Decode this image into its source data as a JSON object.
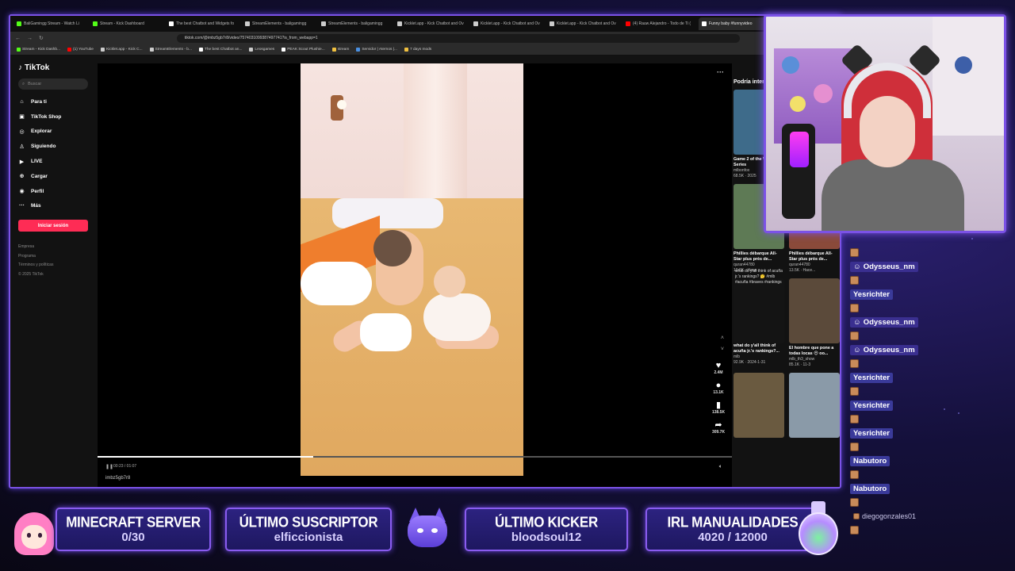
{
  "browser": {
    "tabs": [
      {
        "label": "BaliGamingg Stream - Watch Li",
        "color": "#53fc18",
        "active": false
      },
      {
        "label": "Stream - Kick Dashboard",
        "color": "#53fc18",
        "active": false
      },
      {
        "label": "The best Chatbot and Widgets fo",
        "color": "#ffffff",
        "active": false
      },
      {
        "label": "StreamElements - baligamingg",
        "color": "#cccccc",
        "active": false
      },
      {
        "label": "StreamElements - baligamingg",
        "color": "#cccccc",
        "active": false
      },
      {
        "label": "Kicklet.app - Kick Chatbot and Ov",
        "color": "#cccccc",
        "active": false
      },
      {
        "label": "Kicklet.app - Kick Chatbot and Ov",
        "color": "#cccccc",
        "active": false
      },
      {
        "label": "Kicklet.app - Kick Chatbot and Ov",
        "color": "#cccccc",
        "active": false
      },
      {
        "label": "(4) Rauw Alejandro - Todo de Ti (",
        "color": "#ff0000",
        "active": false
      },
      {
        "label": "Funny baby #funnyvideo",
        "color": "#ffffff",
        "active": true
      }
    ],
    "url": "tiktok.com/@imbz5gb7r8/video/7574031099387497741?is_from_webapp=1",
    "bookmarks": [
      {
        "label": "Stream - Kick Dashb...",
        "color": "#53fc18"
      },
      {
        "label": "(1) YouTube",
        "color": "#ff0000"
      },
      {
        "label": "Kicklet.app - Kick C...",
        "color": "#cccccc"
      },
      {
        "label": "StreamElements - b...",
        "color": "#cccccc"
      },
      {
        "label": "The best Chatbot an...",
        "color": "#ffffff"
      },
      {
        "label": "Leosgames",
        "color": "#cccccc"
      },
      {
        "label": "PEAK Scout Plushie...",
        "color": "#ffffff"
      },
      {
        "label": "stream",
        "color": "#f0c040"
      },
      {
        "label": "Servidor | Aternos |...",
        "color": "#4a90e2"
      },
      {
        "label": "7 days mods",
        "color": "#f0c040"
      }
    ]
  },
  "tiktok": {
    "logo": "TikTok",
    "search_placeholder": "Buscar",
    "nav": [
      {
        "icon": "⌂",
        "label": "Para ti"
      },
      {
        "icon": "▣",
        "label": "TikTok Shop"
      },
      {
        "icon": "◎",
        "label": "Explorar"
      },
      {
        "icon": "♙",
        "label": "Siguiendo"
      },
      {
        "icon": "▶",
        "label": "LIVE"
      },
      {
        "icon": "⊕",
        "label": "Cargar"
      },
      {
        "icon": "◉",
        "label": "Perfil"
      },
      {
        "icon": "···",
        "label": "Más"
      }
    ],
    "login_label": "Iniciar sesión",
    "footer_links": [
      "Empresa",
      "Programa",
      "Términos y políticas",
      "© 2025 TikTok"
    ],
    "video": {
      "time": "00:23 / 01:07",
      "progress": 0.34,
      "author": "imbz5gb7r8",
      "likes": "2.4M",
      "comments": "13.1K",
      "saves": "138.5K",
      "shares": "309.7K"
    },
    "recs_title": "Podría interesarte",
    "recs": [
      {
        "title": "Game 2 of the World Series",
        "user": "mlbonfox",
        "stats": "68.5K · 2025",
        "color": "#3e6b8a"
      },
      {
        "title": "",
        "user": "",
        "stats": "",
        "color": "#121212"
      },
      {
        "title": "Phillies débarque All-Star plus près de...",
        "user": "quran44780",
        "stats": "19.8K · Hace...",
        "color": "#5e7a55"
      },
      {
        "title": "Phillies débarque All-Star plus près de...",
        "user": "quran44780",
        "stats": "13.5K · Hace...",
        "color": "#8a4a3a"
      },
      {
        "title": "what do y'all think of acuña jr.'s rankings?...",
        "user": "mlb",
        "stats": "92.9K · 2024-1-31",
        "color": "#141414"
      },
      {
        "title": "El hombre que pone a todas locas 😍 oo...",
        "user": "mlb_th3_show",
        "stats": "85.1K · 11-3",
        "color": "#5b4a3a"
      },
      {
        "title": "",
        "user": "",
        "stats": "",
        "color": "#6a5a40"
      },
      {
        "title": "",
        "user": "",
        "stats": "",
        "color": "#8a9aa8"
      }
    ],
    "rec_overlay_text": "what do y'all think of acuña jr.'s rankings? 🤔 #mlb #acuña #braves #rankings"
  },
  "chat": [
    {
      "name": "",
      "style": "avatar"
    },
    {
      "name": "Odysseus_nm",
      "style": "badge"
    },
    {
      "name": "",
      "style": "avatar"
    },
    {
      "name": "Yesrichter",
      "style": "plain"
    },
    {
      "name": "",
      "style": "avatar"
    },
    {
      "name": "Odysseus_nm",
      "style": "badge"
    },
    {
      "name": "",
      "style": "avatar"
    },
    {
      "name": "Odysseus_nm",
      "style": "badge"
    },
    {
      "name": "",
      "style": "avatar"
    },
    {
      "name": "Yesrichter",
      "style": "plain"
    },
    {
      "name": "",
      "style": "avatar"
    },
    {
      "name": "Yesrichter",
      "style": "plain"
    },
    {
      "name": "",
      "style": "avatar"
    },
    {
      "name": "Yesrichter",
      "style": "plain"
    },
    {
      "name": "",
      "style": "avatar"
    },
    {
      "name": "Nabutoro",
      "style": "plain"
    },
    {
      "name": "",
      "style": "avatar"
    },
    {
      "name": "Nabutoro",
      "style": "plain"
    },
    {
      "name": "",
      "style": "avatar"
    },
    {
      "name": "diegogonzales01",
      "style": "small"
    },
    {
      "name": "",
      "style": "avatar"
    }
  ],
  "overlay": {
    "panels": [
      {
        "title": "MINECRAFT SERVER",
        "value": "0/30"
      },
      {
        "title": "ÚLTIMO SUSCRIPTOR",
        "value": "elficcionista"
      },
      {
        "title": "ÚLTIMO KICKER",
        "value": "bloodsoul12"
      },
      {
        "title": "IRL MANUALIDADES",
        "value": "4020 / 12000"
      }
    ],
    "accent": "#7b52e6"
  }
}
